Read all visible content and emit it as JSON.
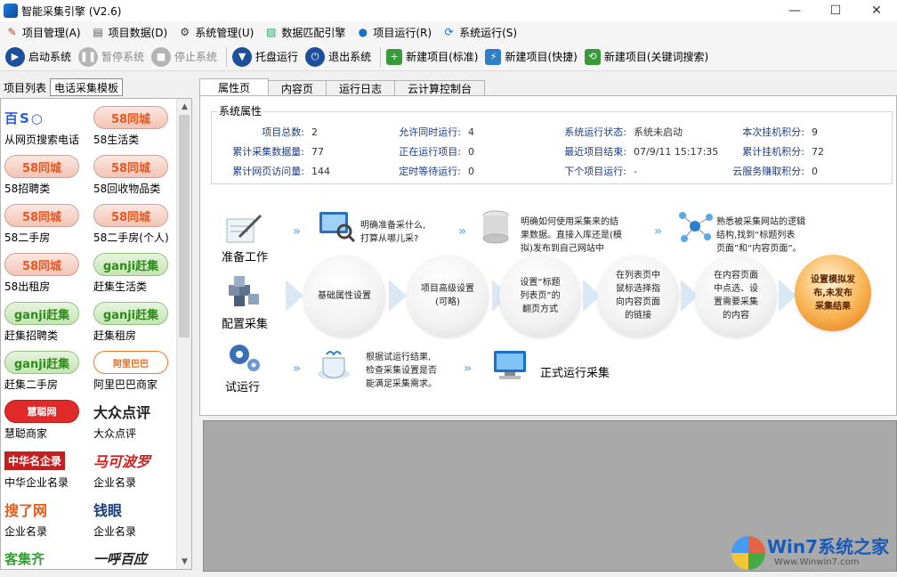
{
  "window": {
    "title": "智能采集引擎 (V2.6)",
    "minimize": "—",
    "maximize": "☐",
    "close": "✕"
  },
  "menu": [
    {
      "label": "项目管理(A)",
      "icon": "project-icon"
    },
    {
      "label": "项目数据(D)",
      "icon": "data-icon"
    },
    {
      "label": "系统管理(U)",
      "icon": "gear-icon"
    },
    {
      "label": "数据匹配引擎",
      "icon": "chart-icon"
    },
    {
      "label": "项目运行(R)",
      "icon": "globe-icon"
    },
    {
      "label": "系统运行(S)",
      "icon": "refresh-icon"
    }
  ],
  "toolbar": {
    "start": "启动系统",
    "pause": "暂停系统",
    "stop": "停止系统",
    "tray": "托盘运行",
    "exit": "退出系统",
    "new_std": "新建项目(标准)",
    "new_quick": "新建项目(快捷)",
    "new_keyword": "新建项目(关键词搜索)"
  },
  "left_tabs": {
    "list": "项目列表",
    "phone": "电话采集模板"
  },
  "templates": [
    {
      "label": "从网页搜索电话",
      "logo": "百S○"
    },
    {
      "label": "58生活类",
      "logo": "58同城"
    },
    {
      "label": "58招聘类",
      "logo": "58同城"
    },
    {
      "label": "58回收物品类",
      "logo": "58同城"
    },
    {
      "label": "58二手房",
      "logo": "58同城"
    },
    {
      "label": "58二手房(个人)",
      "logo": "58同城"
    },
    {
      "label": "58出租房",
      "logo": "58同城"
    },
    {
      "label": "赶集生活类",
      "logo": "ganji赶集"
    },
    {
      "label": "赶集招聘类",
      "logo": "ganji赶集"
    },
    {
      "label": "赶集租房",
      "logo": "ganji赶集"
    },
    {
      "label": "赶集二手房",
      "logo": "ganji赶集"
    },
    {
      "label": "阿里巴巴商家",
      "logo": "阿里巴巴"
    },
    {
      "label": "慧聪商家",
      "logo": "慧聪网"
    },
    {
      "label": "大众点评",
      "logo": "大众点评"
    },
    {
      "label": "中华企业名录",
      "logo": "中华名企录"
    },
    {
      "label": "企业名录",
      "logo": "马可波罗"
    },
    {
      "label": "企业名录",
      "logo": "搜了网"
    },
    {
      "label": "企业名录",
      "logo": "钱眼"
    },
    {
      "label": "",
      "logo": "客集齐"
    },
    {
      "label": "",
      "logo": "一呼百应"
    }
  ],
  "right_tabs": [
    "属性页",
    "内容页",
    "运行日志",
    "云计算控制台"
  ],
  "system": {
    "title": "系统属性",
    "stats": [
      {
        "k": "项目总数:",
        "v": "2"
      },
      {
        "k": "允许同时运行:",
        "v": "4"
      },
      {
        "k": "系统运行状态:",
        "v": "系统未启动"
      },
      {
        "k": "本次挂机积分:",
        "v": "9"
      },
      {
        "k": "累计采集数据量:",
        "v": "77"
      },
      {
        "k": "正在运行项目:",
        "v": "0"
      },
      {
        "k": "最近项目结束:",
        "v": "07/9/11 15:17:35"
      },
      {
        "k": "累计挂机积分:",
        "v": "72"
      },
      {
        "k": "累计网页访问量:",
        "v": "144"
      },
      {
        "k": "定时等待运行:",
        "v": "0"
      },
      {
        "k": "下个项目运行:",
        "v": "-"
      },
      {
        "k": "云服务赚取积分:",
        "v": "0"
      }
    ]
  },
  "flow": {
    "row1_label": "准备工作",
    "row1_t1": [
      "明确准备采什么,",
      "打算从哪儿采?"
    ],
    "row1_t2": [
      "明确如何使用采集来的结",
      "果数据。直接入库还是(模",
      "拟)发布到自己网站中"
    ],
    "row1_t3": [
      "熟悉被采集网站的逻辑",
      "结构,找到“标题列表",
      "页面”和“内容页面”。"
    ],
    "row2_label": "配置采集",
    "circles": [
      [
        "基础属性设置"
      ],
      [
        "项目高级设置",
        "(可略)"
      ],
      [
        "设置“标题",
        "列表页”的",
        "翻页方式"
      ],
      [
        "在列表页中",
        "鼠标选择指",
        "向内容页面",
        "的链接"
      ],
      [
        "在内容页面",
        "中点选、设",
        "置需要采集",
        "的内容"
      ],
      [
        "设置模拟发",
        "布,未发布",
        "采集结果"
      ]
    ],
    "row3_label": "试运行",
    "row3_t1": [
      "根据试运行结果,",
      "检查采集设置是否",
      "能满足采集需求。"
    ],
    "row3_t2": "正式运行采集"
  },
  "watermark": {
    "brand": "Win7系统之家",
    "url": "Www.Winwin7.com"
  }
}
